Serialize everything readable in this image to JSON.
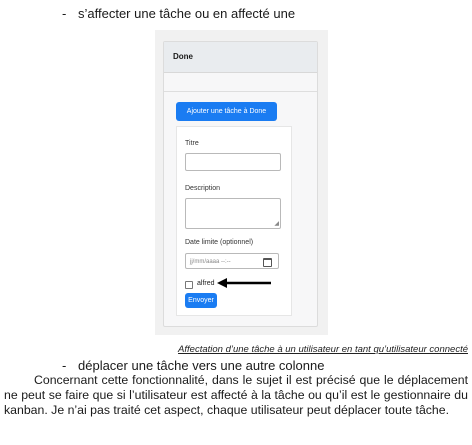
{
  "bullets": {
    "first": "s’affecter une tâche ou en affecté une",
    "second": "déplacer une tâche vers une autre colonne",
    "dash": "-"
  },
  "figure": {
    "column_title": "Done",
    "add_button": "Ajouter une tâche à Done",
    "form": {
      "title_label": "Titre",
      "title_value": "",
      "description_label": "Description",
      "description_value": "",
      "date_label": "Date limite (optionnel)",
      "date_placeholder": "jj/mm/aaaa --:--",
      "user_label": "alfred",
      "user_checked": false,
      "submit_button": "Envoyer"
    },
    "icons": [
      "calendar-icon",
      "arrow-left-icon",
      "resize-handle-icon"
    ],
    "colors": {
      "accent": "#1a7cf2",
      "header_bg": "#e9ecef"
    }
  },
  "caption": "Affectation d’une tâche à un utilisateur en tant qu’utilisateur connecté",
  "paragraph": "Concernant cette fonctionnalité, dans le sujet il est précisé que le déplacement ne peut se faire que si l’utilisateur est affecté à la tâche ou qu’il est le gestionnaire du kanban. Je n’ai pas traité cet aspect, chaque utilisateur peut déplacer toute tâche."
}
